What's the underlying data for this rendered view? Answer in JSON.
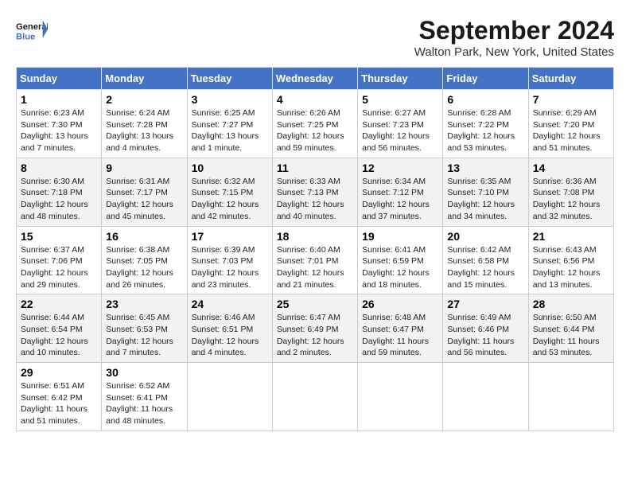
{
  "header": {
    "logo_line1": "General",
    "logo_line2": "Blue",
    "month": "September 2024",
    "location": "Walton Park, New York, United States"
  },
  "days_of_week": [
    "Sunday",
    "Monday",
    "Tuesday",
    "Wednesday",
    "Thursday",
    "Friday",
    "Saturday"
  ],
  "weeks": [
    [
      {
        "day": "1",
        "info": "Sunrise: 6:23 AM\nSunset: 7:30 PM\nDaylight: 13 hours\nand 7 minutes."
      },
      {
        "day": "2",
        "info": "Sunrise: 6:24 AM\nSunset: 7:28 PM\nDaylight: 13 hours\nand 4 minutes."
      },
      {
        "day": "3",
        "info": "Sunrise: 6:25 AM\nSunset: 7:27 PM\nDaylight: 13 hours\nand 1 minute."
      },
      {
        "day": "4",
        "info": "Sunrise: 6:26 AM\nSunset: 7:25 PM\nDaylight: 12 hours\nand 59 minutes."
      },
      {
        "day": "5",
        "info": "Sunrise: 6:27 AM\nSunset: 7:23 PM\nDaylight: 12 hours\nand 56 minutes."
      },
      {
        "day": "6",
        "info": "Sunrise: 6:28 AM\nSunset: 7:22 PM\nDaylight: 12 hours\nand 53 minutes."
      },
      {
        "day": "7",
        "info": "Sunrise: 6:29 AM\nSunset: 7:20 PM\nDaylight: 12 hours\nand 51 minutes."
      }
    ],
    [
      {
        "day": "8",
        "info": "Sunrise: 6:30 AM\nSunset: 7:18 PM\nDaylight: 12 hours\nand 48 minutes."
      },
      {
        "day": "9",
        "info": "Sunrise: 6:31 AM\nSunset: 7:17 PM\nDaylight: 12 hours\nand 45 minutes."
      },
      {
        "day": "10",
        "info": "Sunrise: 6:32 AM\nSunset: 7:15 PM\nDaylight: 12 hours\nand 42 minutes."
      },
      {
        "day": "11",
        "info": "Sunrise: 6:33 AM\nSunset: 7:13 PM\nDaylight: 12 hours\nand 40 minutes."
      },
      {
        "day": "12",
        "info": "Sunrise: 6:34 AM\nSunset: 7:12 PM\nDaylight: 12 hours\nand 37 minutes."
      },
      {
        "day": "13",
        "info": "Sunrise: 6:35 AM\nSunset: 7:10 PM\nDaylight: 12 hours\nand 34 minutes."
      },
      {
        "day": "14",
        "info": "Sunrise: 6:36 AM\nSunset: 7:08 PM\nDaylight: 12 hours\nand 32 minutes."
      }
    ],
    [
      {
        "day": "15",
        "info": "Sunrise: 6:37 AM\nSunset: 7:06 PM\nDaylight: 12 hours\nand 29 minutes."
      },
      {
        "day": "16",
        "info": "Sunrise: 6:38 AM\nSunset: 7:05 PM\nDaylight: 12 hours\nand 26 minutes."
      },
      {
        "day": "17",
        "info": "Sunrise: 6:39 AM\nSunset: 7:03 PM\nDaylight: 12 hours\nand 23 minutes."
      },
      {
        "day": "18",
        "info": "Sunrise: 6:40 AM\nSunset: 7:01 PM\nDaylight: 12 hours\nand 21 minutes."
      },
      {
        "day": "19",
        "info": "Sunrise: 6:41 AM\nSunset: 6:59 PM\nDaylight: 12 hours\nand 18 minutes."
      },
      {
        "day": "20",
        "info": "Sunrise: 6:42 AM\nSunset: 6:58 PM\nDaylight: 12 hours\nand 15 minutes."
      },
      {
        "day": "21",
        "info": "Sunrise: 6:43 AM\nSunset: 6:56 PM\nDaylight: 12 hours\nand 13 minutes."
      }
    ],
    [
      {
        "day": "22",
        "info": "Sunrise: 6:44 AM\nSunset: 6:54 PM\nDaylight: 12 hours\nand 10 minutes."
      },
      {
        "day": "23",
        "info": "Sunrise: 6:45 AM\nSunset: 6:53 PM\nDaylight: 12 hours\nand 7 minutes."
      },
      {
        "day": "24",
        "info": "Sunrise: 6:46 AM\nSunset: 6:51 PM\nDaylight: 12 hours\nand 4 minutes."
      },
      {
        "day": "25",
        "info": "Sunrise: 6:47 AM\nSunset: 6:49 PM\nDaylight: 12 hours\nand 2 minutes."
      },
      {
        "day": "26",
        "info": "Sunrise: 6:48 AM\nSunset: 6:47 PM\nDaylight: 11 hours\nand 59 minutes."
      },
      {
        "day": "27",
        "info": "Sunrise: 6:49 AM\nSunset: 6:46 PM\nDaylight: 11 hours\nand 56 minutes."
      },
      {
        "day": "28",
        "info": "Sunrise: 6:50 AM\nSunset: 6:44 PM\nDaylight: 11 hours\nand 53 minutes."
      }
    ],
    [
      {
        "day": "29",
        "info": "Sunrise: 6:51 AM\nSunset: 6:42 PM\nDaylight: 11 hours\nand 51 minutes."
      },
      {
        "day": "30",
        "info": "Sunrise: 6:52 AM\nSunset: 6:41 PM\nDaylight: 11 hours\nand 48 minutes."
      },
      null,
      null,
      null,
      null,
      null
    ]
  ]
}
